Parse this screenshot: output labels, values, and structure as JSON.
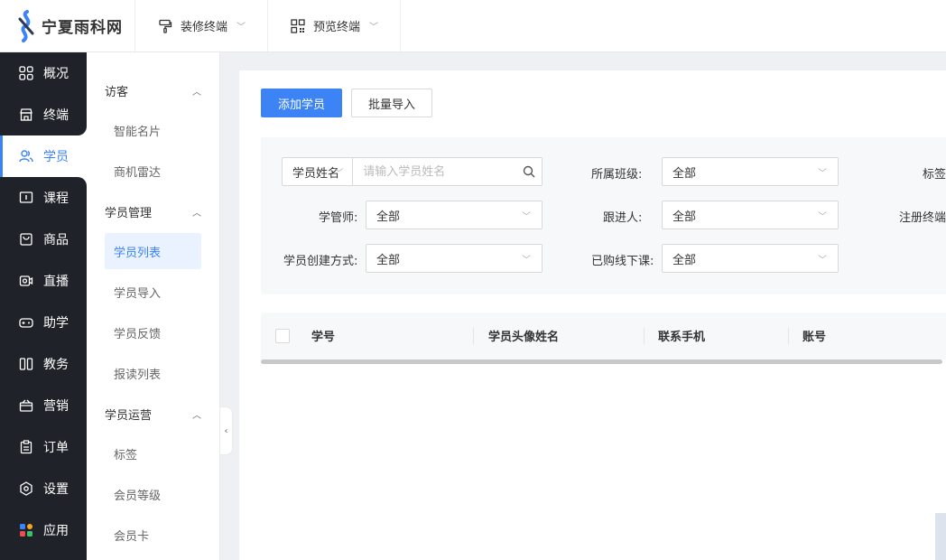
{
  "brand": {
    "name": "宁夏雨科网"
  },
  "topbar": {
    "tabs": [
      {
        "label": "装修终端",
        "icon": "paint-roller-icon"
      },
      {
        "label": "预览终端",
        "icon": "qr-code-icon"
      }
    ]
  },
  "sidebar": {
    "items": [
      {
        "label": "概况",
        "icon": "grid-icon"
      },
      {
        "label": "终端",
        "icon": "store-icon"
      },
      {
        "label": "学员",
        "icon": "users-icon",
        "active": true
      },
      {
        "label": "课程",
        "icon": "course-icon"
      },
      {
        "label": "商品",
        "icon": "bag-icon"
      },
      {
        "label": "直播",
        "icon": "live-icon"
      },
      {
        "label": "助学",
        "icon": "gamepad-icon"
      },
      {
        "label": "教务",
        "icon": "books-icon"
      },
      {
        "label": "营销",
        "icon": "gift-icon"
      },
      {
        "label": "订单",
        "icon": "clipboard-icon"
      },
      {
        "label": "设置",
        "icon": "gear-icon"
      },
      {
        "label": "应用",
        "icon": "apps-icon"
      }
    ]
  },
  "subsidebar": {
    "groups": [
      {
        "title": "访客",
        "items": [
          "智能名片",
          "商机雷达"
        ]
      },
      {
        "title": "学员管理",
        "items": [
          "学员列表",
          "学员导入",
          "学员反馈",
          "报读列表"
        ],
        "active": "学员列表"
      },
      {
        "title": "学员运营",
        "items": [
          "标签",
          "会员等级",
          "会员卡"
        ]
      }
    ]
  },
  "actions": {
    "add": "添加学员",
    "import": "批量导入"
  },
  "filters": {
    "search_type": "学员姓名",
    "search_placeholder": "请输入学员姓名",
    "class_label": "所属班级:",
    "class_value": "全部",
    "tag_label": "标签",
    "manager_label": "学管师:",
    "manager_value": "全部",
    "follower_label": "跟进人:",
    "follower_value": "全部",
    "register_label": "注册终端",
    "create_label": "学员创建方式:",
    "create_value": "全部",
    "purchased_label": "已购线下课:",
    "purchased_value": "全部"
  },
  "table": {
    "columns": [
      "学号",
      "学员头像姓名",
      "联系手机",
      "账号"
    ]
  },
  "colors": {
    "primary": "#3c83f6",
    "sidebar_bg": "#1f2329"
  }
}
